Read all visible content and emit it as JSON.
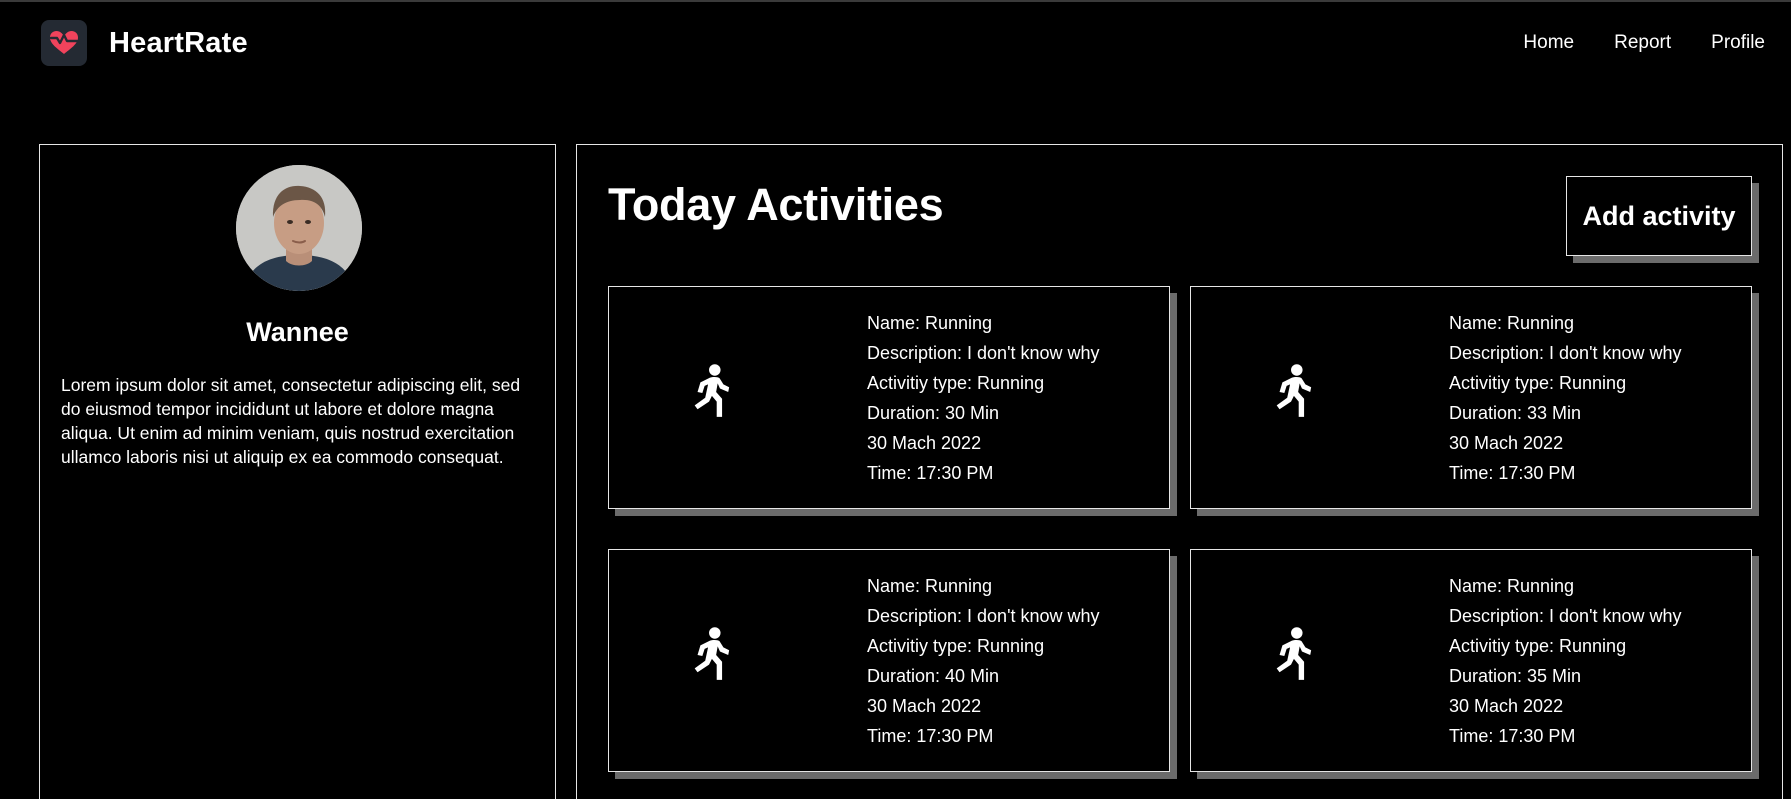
{
  "app": {
    "brand": "HeartRate",
    "logo_icon": "heart-icon",
    "accent_color": "#f0435c"
  },
  "nav": {
    "items": [
      {
        "label": "Home"
      },
      {
        "label": "Report"
      },
      {
        "label": "Profile"
      }
    ]
  },
  "profile": {
    "name": "Wannee",
    "bio": "Lorem ipsum dolor sit amet, consectetur adipiscing elit, sed do eiusmod tempor incididunt ut labore et dolore magna aliqua. Ut enim ad minim veniam, quis nostrud exercitation ullamco laboris nisi ut aliquip ex ea commodo consequat."
  },
  "activities": {
    "title": "Today Activities",
    "add_label": "Add activity",
    "icon": "running-person-icon",
    "items": [
      {
        "name": "Name: Running",
        "description": "Description: I don't know why",
        "type": "Activitiy type: Running",
        "duration": "Duration: 30 Min",
        "date": "30 Mach 2022",
        "time": "Time: 17:30 PM"
      },
      {
        "name": "Name: Running",
        "description": "Description: I don't know why",
        "type": "Activitiy type: Running",
        "duration": "Duration: 33 Min",
        "date": "30 Mach 2022",
        "time": "Time: 17:30 PM"
      },
      {
        "name": "Name: Running",
        "description": "Description: I don't know why",
        "type": "Activitiy type: Running",
        "duration": "Duration: 40 Min",
        "date": "30 Mach 2022",
        "time": "Time: 17:30 PM"
      },
      {
        "name": "Name: Running",
        "description": "Description: I don't know why",
        "type": "Activitiy type: Running",
        "duration": "Duration: 35 Min",
        "date": "30 Mach 2022",
        "time": "Time: 17:30 PM"
      }
    ]
  }
}
